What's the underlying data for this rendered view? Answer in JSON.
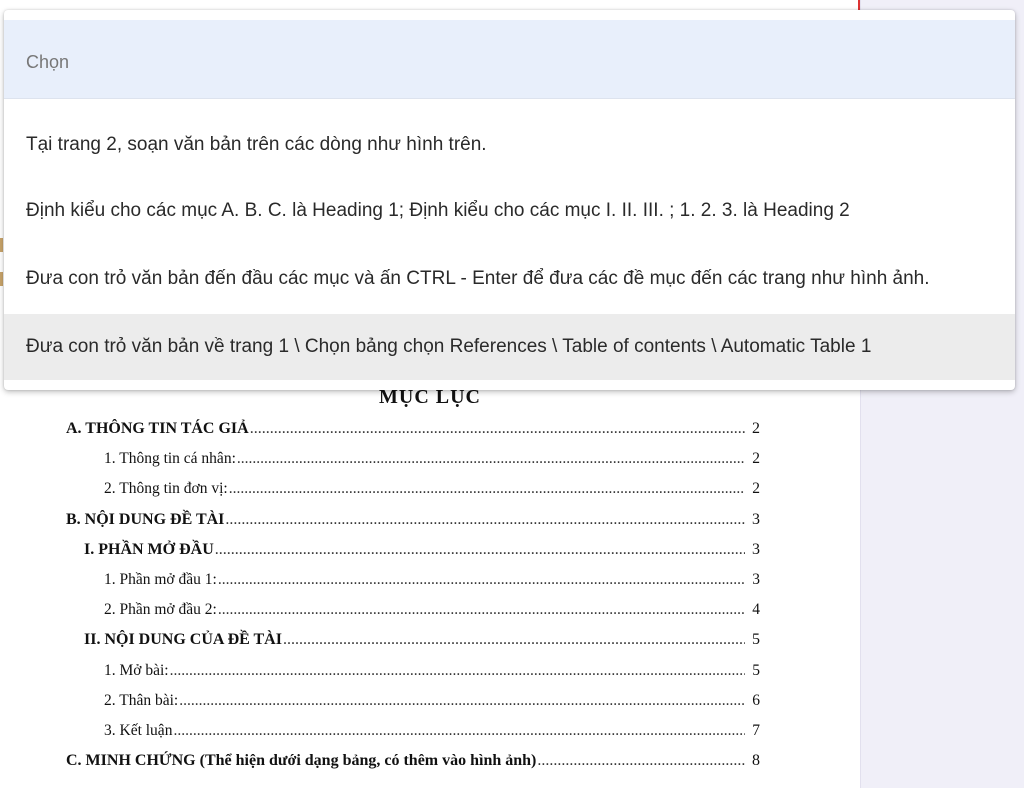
{
  "dropdown": {
    "placeholder": "Chọn",
    "options": [
      "Tại trang 2, soạn văn bản trên các dòng như hình trên.",
      "Định kiểu cho các mục A. B. C. là Heading 1; Định kiểu cho các mục I. II. III. ; 1. 2. 3. là Heading 2",
      "Đưa con trỏ văn bản đến đầu các mục và ấn CTRL - Enter để đưa các đề mục đến các trang như hình ảnh.",
      "Đưa con trỏ văn bản về trang 1 \\ Chọn bảng chọn References \\ Table of contents \\ Automatic Table 1"
    ],
    "highlighted_index": 3
  },
  "toc": {
    "title": "MỤC LỤC",
    "entries": [
      {
        "text": "A. THÔNG TIN TÁC GIẢ",
        "page": "2",
        "level": 1
      },
      {
        "text": "1. Thông tin cá nhân:",
        "page": "2",
        "level": 3
      },
      {
        "text": "2. Thông tin đơn vị:",
        "page": "2",
        "level": 3
      },
      {
        "text": "B. NỘI DUNG ĐỀ TÀI",
        "page": "3",
        "level": 1
      },
      {
        "text": "I. PHẦN MỞ ĐẦU",
        "page": "3",
        "level": 2
      },
      {
        "text": "1. Phần mở đầu 1:",
        "page": "3",
        "level": 3
      },
      {
        "text": "2. Phần mở đầu 2:",
        "page": "4",
        "level": 3
      },
      {
        "text": "II. NỘI DUNG CỦA ĐỀ TÀI",
        "page": "5",
        "level": 2
      },
      {
        "text": "1. Mở bài:",
        "page": "5",
        "level": 3
      },
      {
        "text": "2. Thân bài:",
        "page": "6",
        "level": 3
      },
      {
        "text": "3. Kết luận",
        "page": "7",
        "level": 3
      },
      {
        "text": "C. MINH CHỨNG (Thể hiện dưới dạng bảng, có thêm vào hình ảnh)",
        "page": "8",
        "level": 1
      }
    ]
  }
}
